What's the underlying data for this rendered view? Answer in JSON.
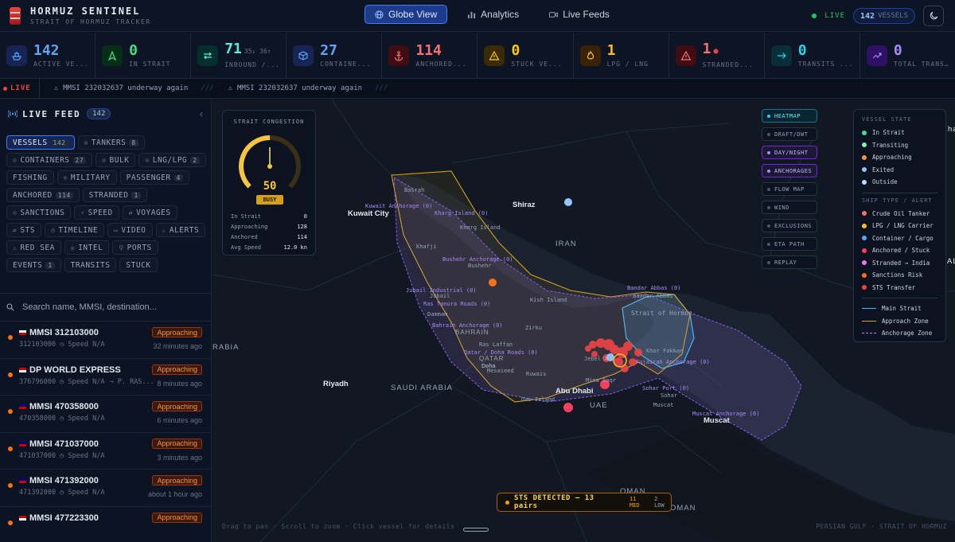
{
  "app": {
    "title": "HORMUZ SENTINEL",
    "subtitle": "STRAIT OF HORMUZ TRACKER"
  },
  "nav": {
    "globe": "Globe View",
    "analytics": "Analytics",
    "live_feeds": "Live Feeds"
  },
  "header": {
    "live": "LIVE",
    "vessel_count": "142",
    "vessel_label": "VESSELS"
  },
  "stats": [
    {
      "value": "142",
      "extra": "",
      "label": "ACTIVE VE...",
      "color": "#60a5fa",
      "bg": "#172554",
      "icon": "ship-icon"
    },
    {
      "value": "0",
      "extra": "",
      "label": "IN STRAIT",
      "color": "#4ade80",
      "bg": "#052e16",
      "icon": "navigation-icon"
    },
    {
      "value": "71",
      "extra": "35↓ 36↑",
      "label": "INBOUND /...",
      "color": "#5eead4",
      "bg": "#042f2e",
      "icon": "swap-icon"
    },
    {
      "value": "27",
      "extra": "",
      "label": "CONTAINE...",
      "color": "#60a5fa",
      "bg": "#172554",
      "icon": "box-icon"
    },
    {
      "value": "114",
      "extra": "",
      "label": "ANCHORED...",
      "color": "#f87171",
      "bg": "#3f0d12",
      "icon": "anchor-icon"
    },
    {
      "value": "0",
      "extra": "",
      "label": "STUCK VE...",
      "color": "#facc15",
      "bg": "#3a2a06",
      "icon": "warning-icon"
    },
    {
      "value": "1",
      "extra": "",
      "label": "LPG / LNG",
      "color": "#fbbf24",
      "bg": "#3a2206",
      "icon": "flame-icon"
    },
    {
      "value": "1",
      "extra": "●",
      "label": "STRANDED...",
      "color": "#f87171",
      "bg": "#3f0d12",
      "icon": "alert-triangle-icon"
    },
    {
      "value": "0",
      "extra": "",
      "label": "TRANSITS ...",
      "color": "#22d3ee",
      "bg": "#082f3a",
      "icon": "arrow-right-icon"
    },
    {
      "value": "0",
      "extra": "",
      "label": "TOTAL TRANSITS",
      "color": "#a78bfa",
      "bg": "#2e1065",
      "icon": "trend-icon"
    }
  ],
  "ticker": {
    "live": "LIVE",
    "items": [
      "MMSI 232032637 underway again",
      "MMSI 232032637 underway again"
    ],
    "sep": "///"
  },
  "sidebar": {
    "title": "LIVE FEED",
    "count": "142",
    "chips": [
      {
        "label": "VESSELS",
        "count": "142",
        "active": true
      },
      {
        "label": "TANKERS",
        "count": "8",
        "active": false
      },
      {
        "label": "CONTAINERS",
        "count": "27",
        "active": false
      },
      {
        "label": "BULK",
        "count": "",
        "active": false
      },
      {
        "label": "LNG/LPG",
        "count": "2",
        "active": false
      },
      {
        "label": "FISHING",
        "count": "",
        "active": false
      },
      {
        "label": "MILITARY",
        "count": "",
        "active": false
      },
      {
        "label": "PASSENGER",
        "count": "4",
        "active": false
      },
      {
        "label": "ANCHORED",
        "count": "114",
        "active": false
      },
      {
        "label": "STRANDED",
        "count": "1",
        "active": false
      },
      {
        "label": "SANCTIONS",
        "count": "",
        "active": false
      },
      {
        "label": "SPEED",
        "count": "",
        "active": false
      },
      {
        "label": "VOYAGES",
        "count": "",
        "active": false
      },
      {
        "label": "STS",
        "count": "",
        "active": false
      },
      {
        "label": "TIMELINE",
        "count": "",
        "active": false
      },
      {
        "label": "VIDEO",
        "count": "",
        "active": false
      },
      {
        "label": "ALERTS",
        "count": "",
        "active": false
      },
      {
        "label": "RED SEA",
        "count": "",
        "active": false
      },
      {
        "label": "INTEL",
        "count": "",
        "active": false
      },
      {
        "label": "PORTS",
        "count": "",
        "active": false
      },
      {
        "label": "EVENTS",
        "count": "1",
        "active": false
      },
      {
        "label": "TRANSITS",
        "count": "",
        "active": false
      },
      {
        "label": "STUCK",
        "count": "",
        "active": false
      }
    ],
    "search_placeholder": "Search name, MMSI, destination...",
    "vessels": [
      {
        "name": "MMSI 312103000",
        "mmsi": "312103000",
        "speed": "Speed N/A",
        "dest": "",
        "status": "Approaching",
        "time": "32 minutes ago"
      },
      {
        "name": "DP WORLD EXPRESS",
        "mmsi": "376796000",
        "speed": "Speed N/A",
        "dest": "→ P. RAS...",
        "status": "Approaching",
        "time": "8 minutes ago"
      },
      {
        "name": "MMSI 470358000",
        "mmsi": "470358000",
        "speed": "Speed N/A",
        "dest": "",
        "status": "Approaching",
        "time": "6 minutes ago"
      },
      {
        "name": "MMSI 471037000",
        "mmsi": "471037000",
        "speed": "Speed N/A",
        "dest": "",
        "status": "Approaching",
        "time": "3 minutes ago"
      },
      {
        "name": "MMSI 471392000",
        "mmsi": "471392000",
        "speed": "Speed N/A",
        "dest": "",
        "status": "Approaching",
        "time": "about 1 hour ago"
      },
      {
        "name": "MMSI 477223300",
        "mmsi": "",
        "speed": "",
        "dest": "",
        "status": "Approaching",
        "time": ""
      }
    ]
  },
  "congestion": {
    "title": "STRAIT CONGESTION",
    "value": "50",
    "level": 0.5,
    "status": "BUSY",
    "rows": [
      {
        "label": "In Strait",
        "value": "0"
      },
      {
        "label": "Approaching",
        "value": "128"
      },
      {
        "label": "Anchored",
        "value": "114"
      },
      {
        "label": "Avg Speed",
        "value": "12.0 kn"
      }
    ]
  },
  "layers": [
    {
      "label": "HEATMAP",
      "style": "cyan"
    },
    {
      "label": "DRAFT/DWT",
      "style": ""
    },
    {
      "label": "DAY/NIGHT",
      "style": "purple"
    },
    {
      "label": "ANCHORAGES",
      "style": "purple"
    },
    {
      "label": "FLOW MAP",
      "style": ""
    },
    {
      "label": "WIND",
      "style": ""
    },
    {
      "label": "EXCLUSIONS",
      "style": ""
    },
    {
      "label": "ETA PATH",
      "style": ""
    },
    {
      "label": "REPLAY",
      "style": ""
    }
  ],
  "legend": {
    "state_title": "VESSEL STATE",
    "states": [
      {
        "label": "In Strait",
        "color": "#4ade80"
      },
      {
        "label": "Transiting",
        "color": "#86efac"
      },
      {
        "label": "Approaching",
        "color": "#fb923c"
      },
      {
        "label": "Exited",
        "color": "#93c5fd"
      },
      {
        "label": "Outside",
        "color": "#bfdbfe"
      }
    ],
    "type_title": "SHIP TYPE / ALERT",
    "types": [
      {
        "label": "Crude Oil Tanker",
        "color": "#f87171"
      },
      {
        "label": "LPG / LNG Carrier",
        "color": "#fbbf24"
      },
      {
        "label": "Container / Cargo",
        "color": "#60a5fa"
      },
      {
        "label": "Anchored / Stuck",
        "color": "#f43f5e"
      },
      {
        "label": "Stranded → India",
        "color": "#e879f9"
      },
      {
        "label": "Sanctions Risk",
        "color": "#f97316"
      },
      {
        "label": "STS Transfer",
        "color": "#ef4444"
      }
    ],
    "lines": [
      {
        "label": "Main Strait",
        "color": "#38bdf8"
      },
      {
        "label": "Approach Zone",
        "color": "#d4a017"
      },
      {
        "label": "Anchorage Zone",
        "color": "#a78bfa"
      }
    ]
  },
  "map": {
    "places": [
      "Kuwait City",
      "Shiraz",
      "Riyadh",
      "Abu Dhabi",
      "Muscat",
      "Doha"
    ],
    "regions": [
      "IRAN",
      "SAUDI ARABIA",
      "UAE",
      "BAHRAIN",
      "QATAR",
      "OMAN",
      "OMAN",
      "RABIA",
      "ALG",
      "ha"
    ],
    "anchorages": [
      "Kuwait Anchorage (0)",
      "Kharg Island (0)",
      "Bushehr Anchorage (0)",
      "Jubail Industrial (0)",
      "Ras Tanura Roads (0)",
      "Bahrain Anchorage (0)",
      "Qatar / Doha Roads (0)",
      "Bandar Abbas (0)",
      "Sohar Port (0)",
      "Muscat Anchorage (0)",
      "Fujairah Anchorage (0)"
    ],
    "pois": [
      "Basrah",
      "Kharg Island",
      "Bushehr",
      "Khafji",
      "Jubail",
      "Dammam",
      "Ras Laffan",
      "Kish Island",
      "Ruwais",
      "Mesaieed",
      "Das Island",
      "Jebel Ali",
      "Khor Fakkan",
      "Sohar",
      "Muscat",
      "Strait of Hormuz",
      "Mina Saqr",
      "Zirku",
      "Bandar Abbas"
    ],
    "sts": "STS DETECTED — 13 pairs",
    "sts_med": "11 MED",
    "sts_low": "2 LOW",
    "hint": "Drag to pan · Scroll to zoom · Click vessel for details",
    "corner": "PERSIAN GULF · STRAIT OF HORMUZ"
  }
}
